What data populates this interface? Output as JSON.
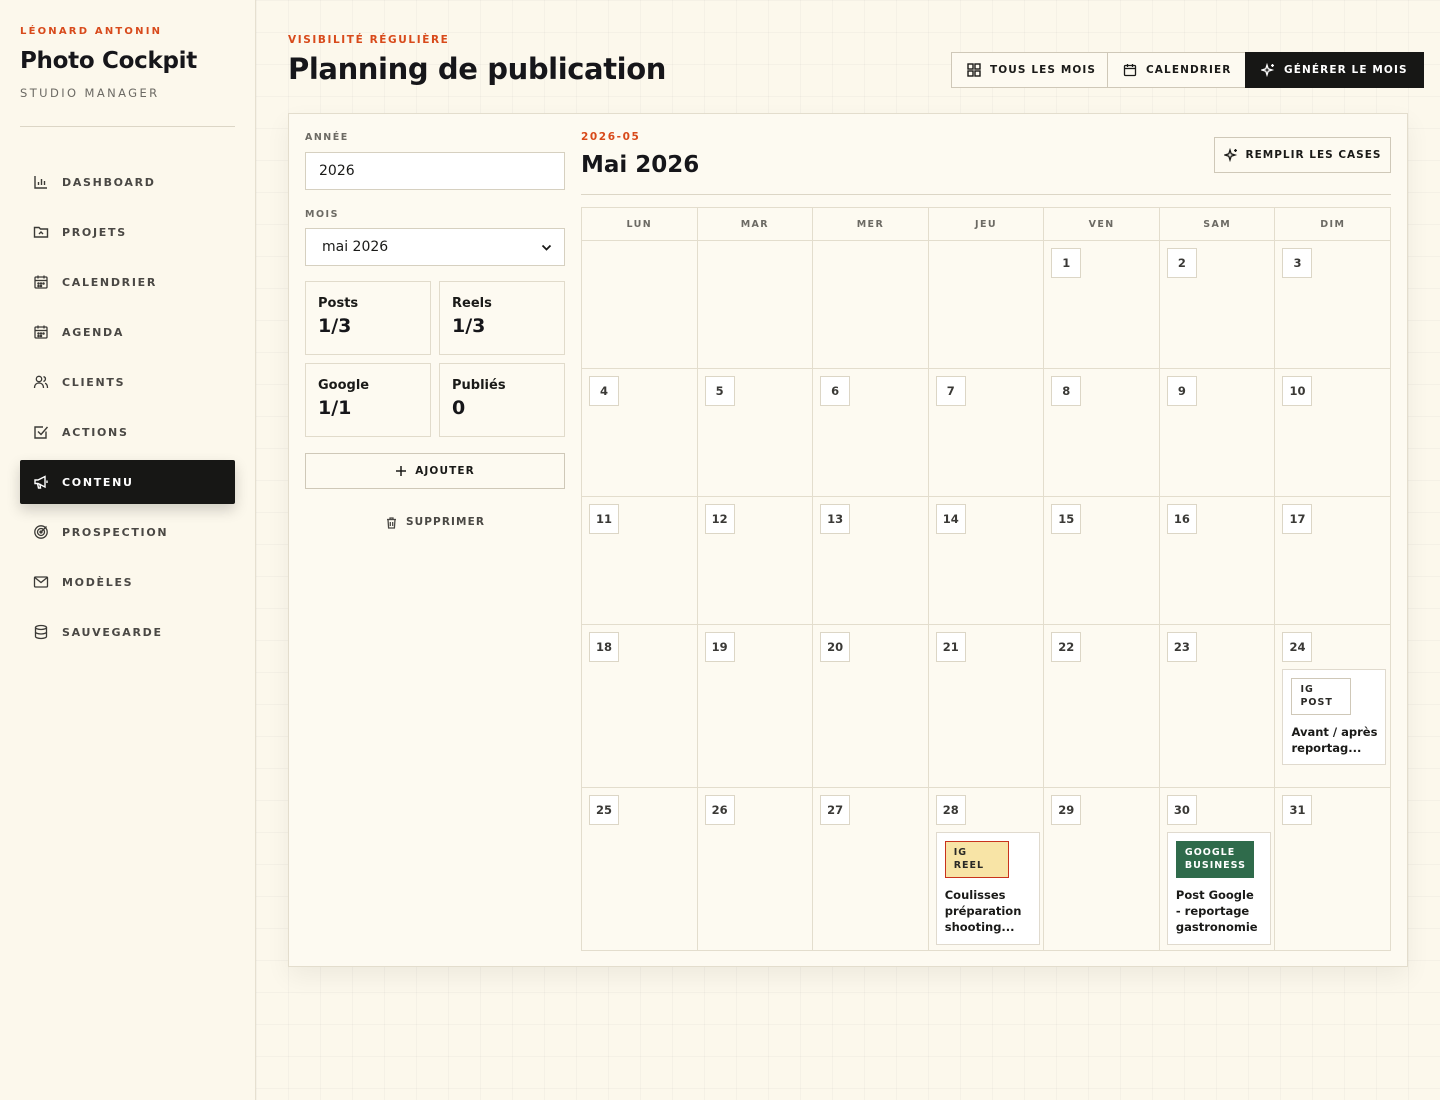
{
  "brand": {
    "owner": "LÉONARD ANTONIN",
    "name": "Photo Cockpit",
    "subtitle": "STUDIO MANAGER"
  },
  "nav": [
    {
      "id": "dashboard",
      "label": "DASHBOARD",
      "icon": "bar-chart-icon",
      "active": false
    },
    {
      "id": "projets",
      "label": "PROJETS",
      "icon": "folder-icon",
      "active": false
    },
    {
      "id": "calendrier",
      "label": "CALENDRIER",
      "icon": "calendar-icon",
      "active": false
    },
    {
      "id": "agenda",
      "label": "AGENDA",
      "icon": "calendar-icon",
      "active": false
    },
    {
      "id": "clients",
      "label": "CLIENTS",
      "icon": "users-icon",
      "active": false
    },
    {
      "id": "actions",
      "label": "ACTIONS",
      "icon": "checkbox-icon",
      "active": false
    },
    {
      "id": "contenu",
      "label": "CONTENU",
      "icon": "megaphone-icon",
      "active": true
    },
    {
      "id": "prospection",
      "label": "PROSPECTION",
      "icon": "target-icon",
      "active": false
    },
    {
      "id": "modeles",
      "label": "MODÈLES",
      "icon": "mail-icon",
      "active": false
    },
    {
      "id": "sauvegarde",
      "label": "SAUVEGARDE",
      "icon": "database-icon",
      "active": false
    }
  ],
  "header": {
    "kicker": "VISIBILITÉ RÉGULIÈRE",
    "title": "Planning de publication",
    "buttons": {
      "all_months": "TOUS LES MOIS",
      "calendar": "CALENDRIER",
      "generate": "GÉNÉRER LE MOIS"
    }
  },
  "filters": {
    "year_label": "ANNÉE",
    "year_value": "2026",
    "month_label": "MOIS",
    "month_value": "mai 2026"
  },
  "stats": [
    {
      "label": "Posts",
      "value": "1/3"
    },
    {
      "label": "Reels",
      "value": "1/3"
    },
    {
      "label": "Google",
      "value": "1/1"
    },
    {
      "label": "Publiés",
      "value": "0"
    }
  ],
  "actions": {
    "add": "AJOUTER",
    "delete": "SUPPRIMER"
  },
  "calendar": {
    "code": "2026-05",
    "title": "Mai 2026",
    "fill_button": "REMPLIR LES CASES",
    "weekdays": [
      "LUN",
      "MAR",
      "MER",
      "JEU",
      "VEN",
      "SAM",
      "DIM"
    ],
    "weeks": [
      [
        "",
        "",
        "",
        "",
        "1",
        "2",
        "3"
      ],
      [
        "4",
        "5",
        "6",
        "7",
        "8",
        "9",
        "10"
      ],
      [
        "11",
        "12",
        "13",
        "14",
        "15",
        "16",
        "17"
      ],
      [
        "18",
        "19",
        "20",
        "21",
        "22",
        "23",
        "24"
      ],
      [
        "25",
        "26",
        "27",
        "28",
        "29",
        "30",
        "31"
      ]
    ],
    "events": [
      {
        "day": "24",
        "tag": "IG POST",
        "type": "post",
        "title": "Avant / après reportag..."
      },
      {
        "day": "28",
        "tag": "IG REEL",
        "type": "reel",
        "title": "Coulisses préparation shooting..."
      },
      {
        "day": "30",
        "tag": "GOOGLE BUSINESS",
        "type": "google",
        "title": "Post Google - reportage gastronomie"
      }
    ]
  }
}
